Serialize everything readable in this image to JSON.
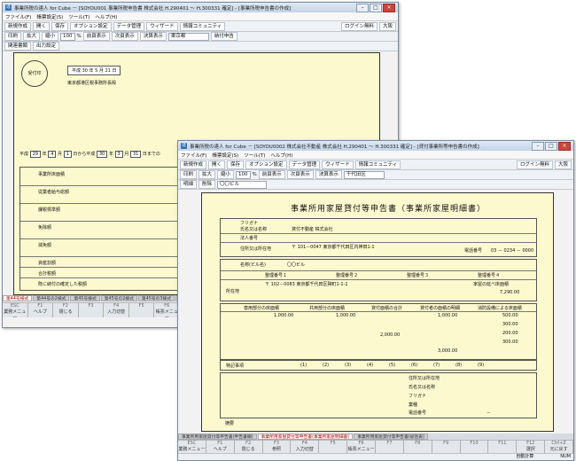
{
  "back_window": {
    "title": "事業所税の達人 for Cube － [SOYOU001 事業所税申告書  株式会社 H.290401 ～ H.300331 確定] - [事業所税申告書の作成]",
    "menu": [
      "ファイル(F)",
      "帳票設定(S)",
      "ツール(T)",
      "ヘルプ(H)"
    ],
    "toolbar": [
      "新規作成",
      "開く",
      "保存",
      "オプション設定",
      "データ管理",
      "ウィザード",
      "情報コミュニティ",
      "ログイン無料",
      "大阪"
    ],
    "subbar": [
      "印刷",
      "拡大",
      "縮小",
      "100",
      "%",
      "前頁表示",
      "次頁表示",
      "決算表示",
      "東京都",
      "納付申告"
    ],
    "subbar2": [
      "関連書類",
      "出力設定"
    ],
    "form": {
      "receipt": "受付印",
      "year": "平成 30 年 5 月 21 日",
      "office": "東京都港区税事務所長殿",
      "nav_label": "前各号",
      "date_row": [
        "平成",
        "29",
        "年",
        "4",
        "月",
        "1",
        "日から平成",
        "30",
        "年",
        "3",
        "月",
        "31",
        "日までの"
      ],
      "sections": [
        "事業所床面積",
        "従業者給与総額",
        "課税標準額",
        "免除額",
        "減免額"
      ],
      "rows": [
        "資産割額",
        "従業者割額",
        "合計税額",
        "既に納付の確定した税額",
        "差引納付すべき税額"
      ],
      "footer_row": "既に納付の確定した税額"
    },
    "tabs": [
      "第44号様式",
      "第44号の2様式",
      "第45号様式",
      "第45号の2様式",
      "第45号の3様式",
      "第46号様式",
      "第46号の2様式"
    ],
    "fkeys": [
      {
        "n": "ESC",
        "l": "業務メニュー"
      },
      {
        "n": "F1",
        "l": "ヘルプ"
      },
      {
        "n": "F2",
        "l": "閉じる"
      },
      {
        "n": "F3",
        "l": ""
      },
      {
        "n": "F4",
        "l": "入力切替"
      },
      {
        "n": "F5",
        "l": ""
      },
      {
        "n": "F6",
        "l": "帳票メニュー"
      }
    ]
  },
  "front_window": {
    "title": "事業所税の達人 for Cube － [SOYOU0002 株式会社不動産  株式会社 H.290401 ～ H.300331 確定] - [貸付事業所等申告書の作成]",
    "menu": [
      "ファイル(F)",
      "帳票設定(S)",
      "ツール(T)",
      "ヘルプ(H)"
    ],
    "toolbar": [
      "新規作成",
      "開く",
      "保存",
      "オプション設定",
      "データ管理",
      "ウィザード",
      "情報コミュニティ",
      "ログイン無料",
      "大阪"
    ],
    "subbar": [
      "印刷",
      "拡大",
      "縮小",
      "100",
      "%",
      "前頁表示",
      "次頁表示",
      "決算表示",
      "千代田区"
    ],
    "subbar2": [
      "明細",
      "削除",
      "〇〇ビル"
    ],
    "form": {
      "title": "事業所用家屋貸付等申告書（事業所家屋明細書）",
      "furigana": "フリガナ",
      "name_label": "氏名又は名称",
      "name_value": "貸付不動産 株式会社",
      "rep_label": "法人番号",
      "addr_label": "住所又は所在地",
      "addr_value": "〒 101－0047 東京都千代田区内神田1-1",
      "tel_label": "電話番号",
      "tel_value": "03 － 0234 － 0000",
      "building_label": "名称(ビル名)",
      "building_value": "〇〇ビル",
      "reg1": "整理番号１",
      "reg2": "整理番号２",
      "reg3": "整理番号３",
      "reg4": "整理番号４",
      "loc_label": "所在地",
      "loc_value": "〒 102－0083 東京都千代田区麹町1-1-1",
      "area_label": "家屋の延べ床面積",
      "area_value": "7,290.00",
      "col_heads": [
        "専用部分の床面積",
        "共用部分の床面積",
        "貸付面積の合計",
        "貸付者の面積の明細",
        "消防設備による床面積"
      ],
      "nums": [
        "1,000.00",
        "1,000.00",
        "2,000.00",
        "1,000.00",
        "500.00",
        "300.00",
        "200.00",
        "300.00",
        "3,000.00"
      ],
      "check_labels": [
        "(1)",
        "(2)",
        "(3)",
        "(4)",
        "(5)",
        "(6)",
        "(7)",
        "(8)",
        "(9)"
      ],
      "tenant_head": "特記事項",
      "tenant_rows": [
        "住所又は所在地",
        "氏名又は名称",
        "フリガナ",
        "業種",
        "電話番号"
      ],
      "tenant_tel": "－",
      "remarks": "摘要"
    },
    "tabs": [
      "事業所用家屋貸付等申告書(申告書欄)",
      "事業所用家屋貸付等申告書(事業所家屋明細書)",
      "事業所用家屋貸付等申告書(総括表)"
    ],
    "fkeys": [
      {
        "n": "ESC",
        "l": "業務メニュー"
      },
      {
        "n": "F1",
        "l": "ヘルプ"
      },
      {
        "n": "F2",
        "l": "閉じる"
      },
      {
        "n": "F3",
        "l": "参照"
      },
      {
        "n": "F4",
        "l": "入力切替"
      },
      {
        "n": "F5",
        "l": ""
      },
      {
        "n": "F6",
        "l": "帳票メニュー"
      },
      {
        "n": "F7",
        "l": ""
      },
      {
        "n": "F8",
        "l": ""
      },
      {
        "n": "F9",
        "l": ""
      },
      {
        "n": "F10",
        "l": ""
      },
      {
        "n": "F11",
        "l": ""
      },
      {
        "n": "F12",
        "l": "選択"
      },
      {
        "n": "Ctrl+Z",
        "l": "元に戻す"
      }
    ],
    "status": [
      "",
      "NUM"
    ],
    "status_right": "自動計算"
  }
}
